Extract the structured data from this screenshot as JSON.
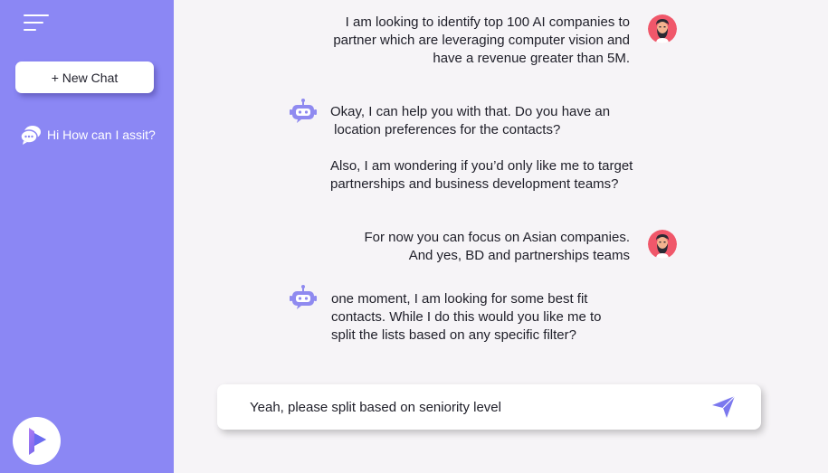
{
  "sidebar": {
    "new_chat_label": "+ New Chat",
    "history": [
      {
        "label": "Hi How can I assit?",
        "icon": "chat-bubbles-icon"
      }
    ],
    "menu_icon": "hamburger-menu-icon",
    "logo_icon": "brand-play-logo-icon"
  },
  "conversation": {
    "messages": [
      {
        "role": "user",
        "lines": [
          "I am looking to identify top 100 AI companies to",
          "partner which are leveraging computer vision and",
          "have a revenue greater than 5M."
        ]
      },
      {
        "role": "assistant",
        "lines": [
          "Okay, I can help you with that. Do you have an",
          " location preferences for the contacts?",
          "Also, I am wondering if you’d only like me to target",
          "partnerships and business development teams?"
        ]
      },
      {
        "role": "user",
        "lines": [
          "For now you can focus on Asian companies.",
          "And yes, BD and partnerships teams"
        ]
      },
      {
        "role": "assistant",
        "lines": [
          "one moment, I am looking for some best fit",
          "contacts. While I do this would you like me to",
          "split the lists based on any specific filter?"
        ]
      }
    ]
  },
  "composer": {
    "value": "Yeah, please split based on seniority level",
    "send_icon": "send-paper-plane-icon"
  },
  "colors": {
    "sidebar_bg": "#8b87f4",
    "page_bg": "#f6f4f7",
    "accent": "#7b78ee",
    "bot_icon": "#8f8af0",
    "avatar_bg": "#f0576a"
  }
}
